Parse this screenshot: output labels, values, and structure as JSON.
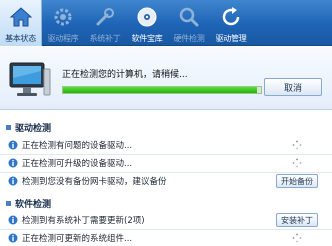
{
  "toolbar": {
    "items": [
      {
        "label": "基本状态",
        "icon": "home-icon"
      },
      {
        "label": "驱动程序",
        "icon": "gear-icon"
      },
      {
        "label": "系统补丁",
        "icon": "wrench-icon"
      },
      {
        "label": "软件宝库",
        "icon": "disc-icon"
      },
      {
        "label": "硬件检测",
        "icon": "magnifier-icon"
      },
      {
        "label": "驱动管理",
        "icon": "refresh-icon"
      }
    ]
  },
  "status": {
    "message": "正在检测您的计算机，请稍候...",
    "progress": 0.98,
    "cancel_label": "取消"
  },
  "driver_section": {
    "title": "驱动检测",
    "rows": [
      {
        "text": "正在检测有问题的设备驱动..."
      },
      {
        "text": "正在检测可升级的设备驱动..."
      },
      {
        "text": "检测到您没有备份网卡驱动，建议备份",
        "button": "开始备份"
      }
    ]
  },
  "software_section": {
    "title": "软件检测",
    "rows": [
      {
        "text": "检测到有系统补丁需要更新(2项)",
        "button": "安装补丁"
      },
      {
        "text": "正在检测可更新的系统组件..."
      }
    ]
  },
  "colors": {
    "toolbar_blue": "#1e64b6",
    "progress_green": "#2fbf16",
    "info_icon_blue": "#2f76c9"
  }
}
